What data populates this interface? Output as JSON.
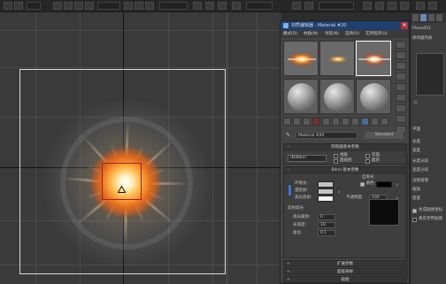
{
  "material_editor": {
    "title": "材质编辑器 - Material #20",
    "close_label": "✕",
    "menus": [
      "模式(D)",
      "材质(M)",
      "导航(N)",
      "选项(O)",
      "实用程序(U)"
    ],
    "material_name": "Material #20",
    "material_type": "Standard",
    "shader_rollout": {
      "header": "明暗器基本参数",
      "shader": "(B)Blinn",
      "options": [
        "线框",
        "双面",
        "面贴图",
        "面状"
      ]
    },
    "blinn_rollout": {
      "header": "Blinn 基本参数",
      "self_illum_header": "自发光",
      "color_label": "颜色",
      "ambient_label": "环境光:",
      "diffuse_label": "漫反射:",
      "specular_label": "高光反射:",
      "opacity_label": "不透明度:",
      "opacity_value": "100",
      "highlights_header": "反射高光",
      "spec_level_label": "高光级别:",
      "spec_level_value": "0",
      "glossiness_label": "光泽度:",
      "glossiness_value": "10",
      "soften_label": "柔化:",
      "soften_value": "0.1"
    },
    "collapsed_rollouts": [
      "扩展参数",
      "超级采样",
      "贴图",
      "mental ray 连接"
    ]
  },
  "command_panel": {
    "object_name": "Plane001",
    "modifier_list_label": "修改器列表",
    "items": [
      "平面",
      "长度",
      "宽度",
      "长度分段",
      "宽度分段",
      "渲染倍增",
      "缩放",
      "密度",
      "生成贴图坐标",
      "真实世界贴图"
    ]
  },
  "colors": {
    "title_bar": "#1f3f6e",
    "frame": "#d8d8d8",
    "gizmo": "#a32020",
    "flare_core": "#ffb648"
  }
}
